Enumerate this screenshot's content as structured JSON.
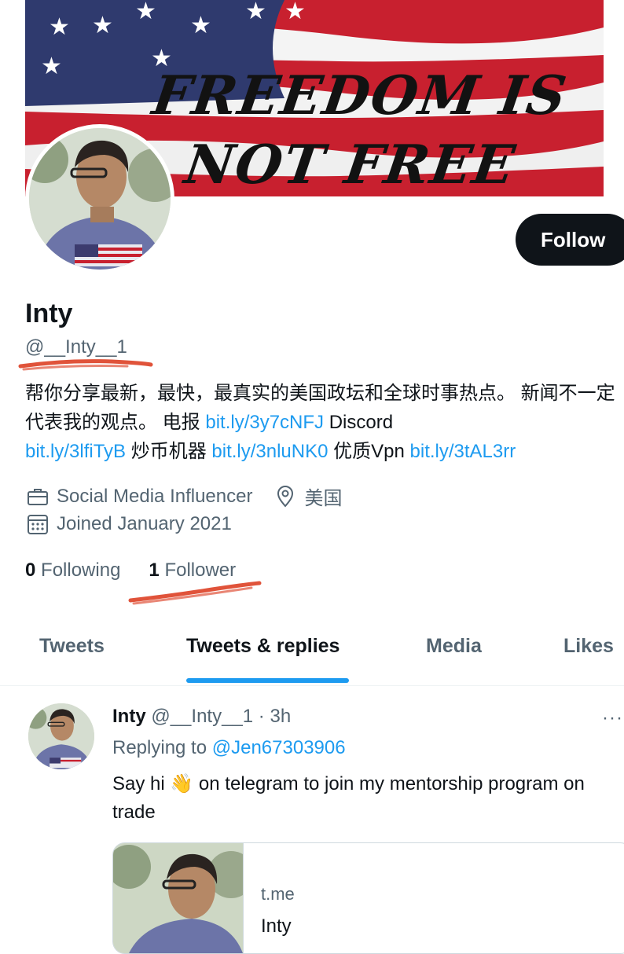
{
  "banner": {
    "slogan_line1": "FREEDOM IS",
    "slogan_line2": "NOT FREE"
  },
  "profile": {
    "name": "Inty",
    "handle": "@__Inty__1",
    "follow_label": "Follow",
    "bio": {
      "p1": "帮你分享最新，最快，最真实的美国政坛和全球时事热点。 新闻不一定代表我的观点。 电报 ",
      "link1": "bit.ly/3y7cNFJ",
      "p2": " Discord ",
      "link2": "bit.ly/3lfiTyB",
      "p3": " 炒币机器 ",
      "link3": "bit.ly/3nluNK0",
      "p4": " 优质Vpn ",
      "link4": "bit.ly/3tAL3rr"
    },
    "category": "Social Media Influencer",
    "location": "美国",
    "joined": "Joined January 2021",
    "following_count": "0",
    "following_label": "Following",
    "followers_count": "1",
    "followers_label": "Follower"
  },
  "tabs": [
    {
      "label": "Tweets"
    },
    {
      "label": "Tweets & replies"
    },
    {
      "label": "Media"
    },
    {
      "label": "Likes"
    }
  ],
  "active_tab": "Tweets & replies",
  "tweet": {
    "author": "Inty",
    "handle": "@__Inty__1",
    "separator": " · ",
    "time": "3h",
    "replying_prefix": "Replying to ",
    "replying_to": "@Jen67303906",
    "text_before": "Say hi ",
    "emoji": "👋",
    "text_after": " on telegram to join my mentorship program on trade",
    "more": "···",
    "card": {
      "domain": "t.me",
      "title": "Inty"
    }
  },
  "colors": {
    "accent": "#1d9bf0",
    "text": "#0f1419",
    "muted": "#536471",
    "annotation": "#e0533a"
  }
}
